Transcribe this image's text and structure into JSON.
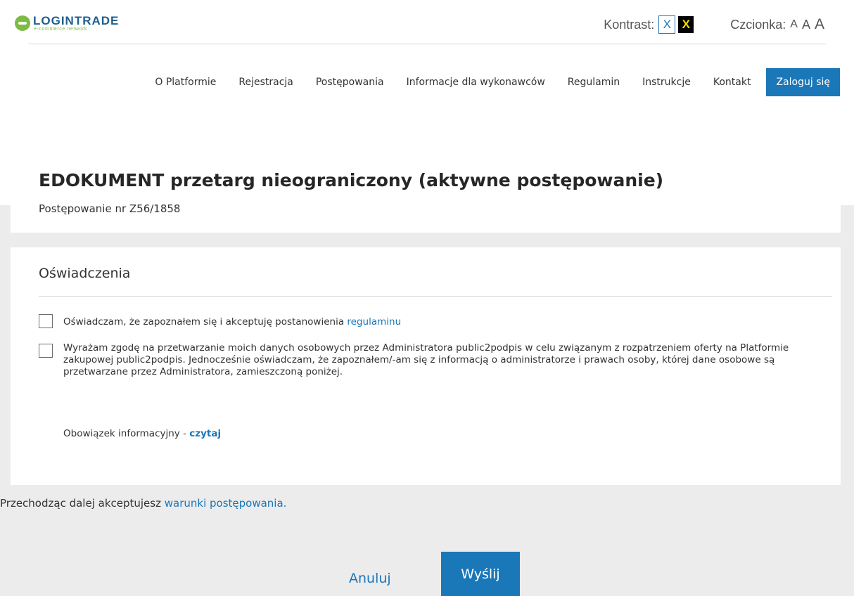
{
  "brand": {
    "logo_text": "LOGINTRADE",
    "logo_sub": "e-commerce network"
  },
  "topbar": {
    "contrast_label": "Kontrast:",
    "contrast_normal": "X",
    "contrast_high": "X",
    "font_label": "Czcionka:",
    "font_small": "A",
    "font_medium": "A",
    "font_large": "A"
  },
  "nav": {
    "items": [
      "O Platformie",
      "Rejestracja",
      "Postępowania",
      "Informacje dla wykonawców",
      "Regulamin",
      "Instrukcje",
      "Kontakt"
    ],
    "login": "Zaloguj się"
  },
  "page": {
    "title": "EDOKUMENT przetarg nieograniczony (aktywne postępowanie)",
    "subtitle": "Postępowanie nr Z56/1858"
  },
  "declarations": {
    "title": "Oświadczenia",
    "item1_text": "Oświadczam, że zapoznałem się i akceptuję postanowienia ",
    "item1_link": "regulaminu",
    "item2_text": "Wyrażam zgodę na przetwarzanie moich danych osobowych przez Administratora public2podpis w celu związanym z rozpatrzeniem oferty na Platformie zakupowej public2podpis. Jednocześnie oświadczam, że zapoznałem/-am się z informacją o administratorze i prawach osoby, której dane osobowe są przetwarzane przez Administratora, zamieszczoną poniżej.",
    "info_text": "Obowiązek informacyjny - ",
    "info_link": "czytaj"
  },
  "footer": {
    "note_text": "Przechodząc dalej akceptujesz ",
    "note_link": "warunki postępowania.",
    "cancel": "Anuluj",
    "send": "Wyślij"
  },
  "colors": {
    "accent": "#1a77b8",
    "brand_green": "#7dbb42",
    "background": "#ececec"
  }
}
